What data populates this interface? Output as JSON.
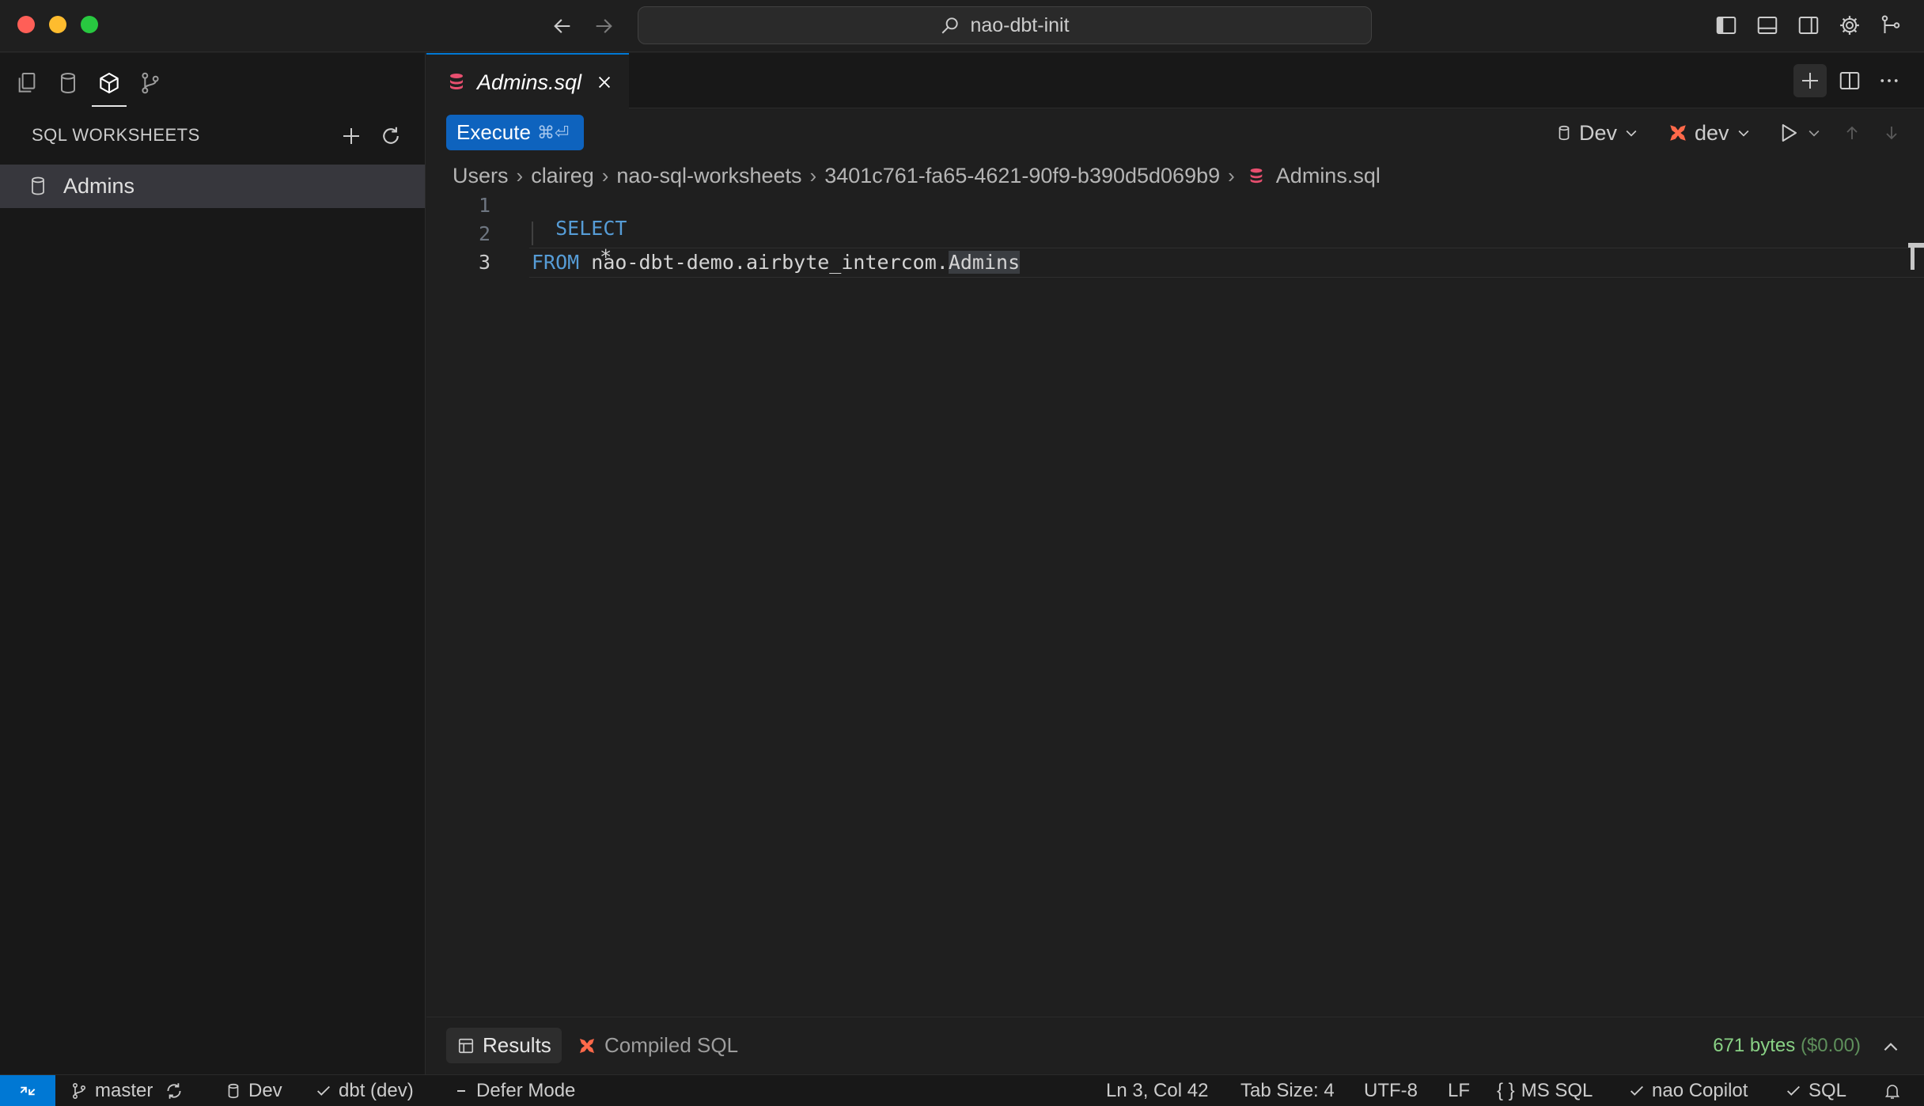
{
  "titlebar": {
    "search_text": "nao-dbt-init"
  },
  "sidebar": {
    "title": "SQL WORKSHEETS",
    "items": [
      {
        "label": "Admins"
      }
    ]
  },
  "editor": {
    "tab": {
      "title": "Admins.sql"
    },
    "execute": {
      "label": "Execute",
      "shortcut": "⌘⏎"
    },
    "target": {
      "connection": "Dev",
      "profile": "dev"
    },
    "breadcrumb": [
      "Users",
      "claireg",
      "nao-sql-worksheets",
      "3401c761-fa65-4621-90f9-b390d5d069b9",
      "Admins.sql"
    ],
    "line_numbers": [
      "1",
      "2",
      "3"
    ],
    "code": {
      "line1_kw": "SELECT",
      "line2": "*",
      "line3_kw": "FROM",
      "line3_table_prefix": "nao-dbt-demo.airbyte_intercom.",
      "line3_table_name": "Admins"
    }
  },
  "panel": {
    "results_label": "Results",
    "compiled_label": "Compiled SQL",
    "bytes": "671 bytes",
    "cost": "($0.00)"
  },
  "statusbar": {
    "branch": "master",
    "connection": "Dev",
    "dbt": "dbt (dev)",
    "defer": "Defer Mode",
    "position": "Ln 3, Col 42",
    "tab_size": "Tab Size: 4",
    "encoding": "UTF-8",
    "eol": "LF",
    "language": "MS SQL",
    "copilot": "nao Copilot",
    "sql": "SQL"
  },
  "colors": {
    "accent": "#0078d4",
    "execute": "#0e63be",
    "dbt_orange": "#ff694a",
    "sql_icon": "#e84f6f",
    "success": "#89d185"
  }
}
